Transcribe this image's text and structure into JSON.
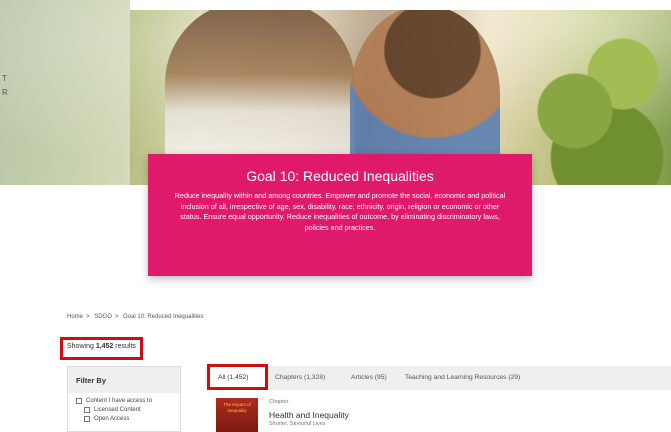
{
  "hero": {
    "ghost_text": "T\nR",
    "goal_title": "Goal 10: Reduced Inequalities",
    "goal_description": "Reduce inequality within and among countries. Empower and promote the social, economic and political inclusion of all, irrespective of age, sex, disability, race, ethnicity, origin, religion or economic or other status. Ensure equal opportunity. Reduce inequalities of outcome, by eliminating discriminatory laws, policies and practices."
  },
  "breadcrumb": {
    "items": [
      "Home",
      "SDGO",
      "Goal 10: Reduced Inequalities"
    ],
    "separator": ">"
  },
  "results": {
    "prefix": "Showing",
    "count": "1,452",
    "suffix": "results"
  },
  "filter": {
    "title": "Filter By",
    "options": [
      {
        "label": "Content I have access to",
        "checked": false
      },
      {
        "label": "Licensed Content",
        "checked": false
      },
      {
        "label": "Open Access",
        "checked": false
      }
    ]
  },
  "tabs": [
    {
      "label": "All",
      "count": "(1,452)",
      "active": true
    },
    {
      "label": "Chapters",
      "count": "(1,328)",
      "active": false
    },
    {
      "label": "Articles",
      "count": "(95)",
      "active": false
    },
    {
      "label": "Teaching and Learning Resources",
      "count": "(29)",
      "active": false
    }
  ],
  "result_item": {
    "thumbnail_title": "The Impact of Inequality",
    "type": "Chapter",
    "title": "Health and Inequality",
    "subtitle": "Shorter, Stressful Lives"
  },
  "colors": {
    "goal_pink": "#e01a6b",
    "highlight_red": "#cc1010",
    "tab_bar_bg": "#efefef"
  }
}
